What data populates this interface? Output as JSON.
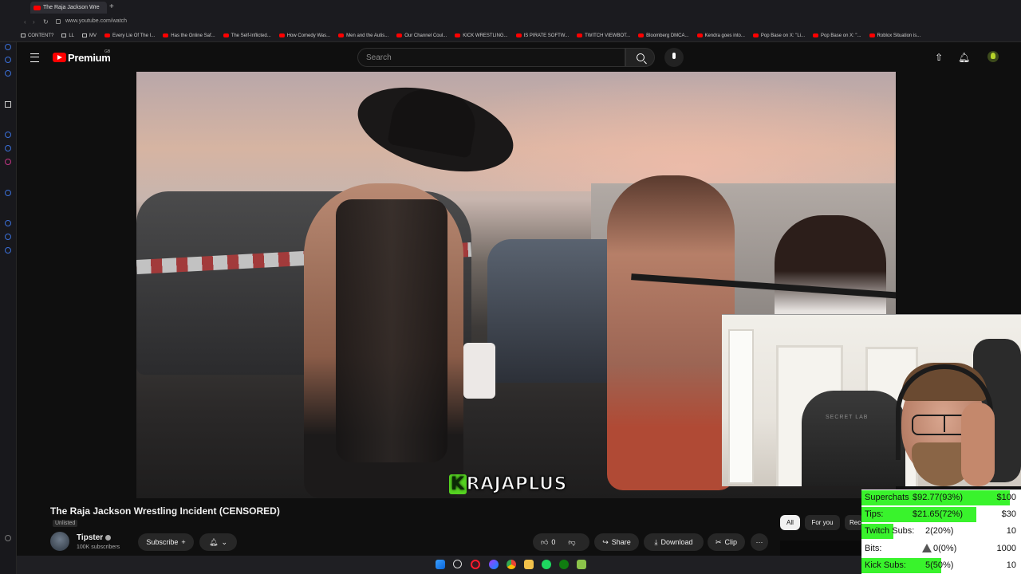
{
  "browser": {
    "tab_title": "The Raja Jackson Wre",
    "url": "www.youtube.com/watch",
    "bookmarks": [
      "CONTENT?",
      "LL",
      "MV",
      "Every Lie Of The I...",
      "Has the Online Saf...",
      "The Self-Inflicted...",
      "How Comedy Was...",
      "Men and the Autis...",
      "Our Channel Coul...",
      "KICK WRESTLING...",
      "IS PIRATE SOFTW...",
      "TWITCH VIEWBOT...",
      "Bloomberg DMCA...",
      "Kendra goes into...",
      "Pop Base on X: \"Li...",
      "Pop Base on X: \"...",
      "Roblox Situation is..."
    ]
  },
  "youtube": {
    "logo_text": "Premium",
    "logo_region": "GB",
    "search_placeholder": "Search",
    "video": {
      "watermark_k": "K",
      "watermark_rest": "RAJAPLUS",
      "title": "The Raja Jackson Wrestling Incident (CENSORED)",
      "visibility": "Unlisted",
      "channel_name": "Tipster",
      "subscribers": "100K subscribers",
      "subscribe_label": "Subscribe",
      "likes": "0",
      "share_label": "Share",
      "download_label": "Download",
      "clip_label": "Clip",
      "more_label": "···"
    },
    "chips": [
      "All",
      "For you",
      "Rec"
    ]
  },
  "stream_stats": {
    "rows": [
      {
        "label": "Superchats",
        "value": "$92.77(93%)",
        "goal": "$100",
        "progress": 0.93
      },
      {
        "label": "Tips:",
        "value": "$21.65(72%)",
        "goal": "$30",
        "progress": 0.72
      },
      {
        "label": "Twitch Subs:",
        "value": "2(20%)",
        "goal": "10",
        "progress": 0.2
      },
      {
        "label": "Bits:",
        "value": "0(0%)",
        "goal": "1000",
        "progress": 0.0
      },
      {
        "label": "Kick Subs:",
        "value": "5(50%)",
        "goal": "10",
        "progress": 0.5
      }
    ],
    "bar_color": "#39f32c"
  },
  "webcam": {
    "chair_brand": "SECRET LAB"
  },
  "icons": {
    "header": [
      "menu-icon",
      "search-icon",
      "mic-icon",
      "upload-icon",
      "bell-icon",
      "avatar"
    ],
    "taskbar": [
      "windows-start-icon",
      "search-icon",
      "opera-icon",
      "messenger-icon",
      "chrome-icon",
      "file-explorer-icon",
      "spotify-icon",
      "xbox-icon",
      "app-icon"
    ]
  }
}
